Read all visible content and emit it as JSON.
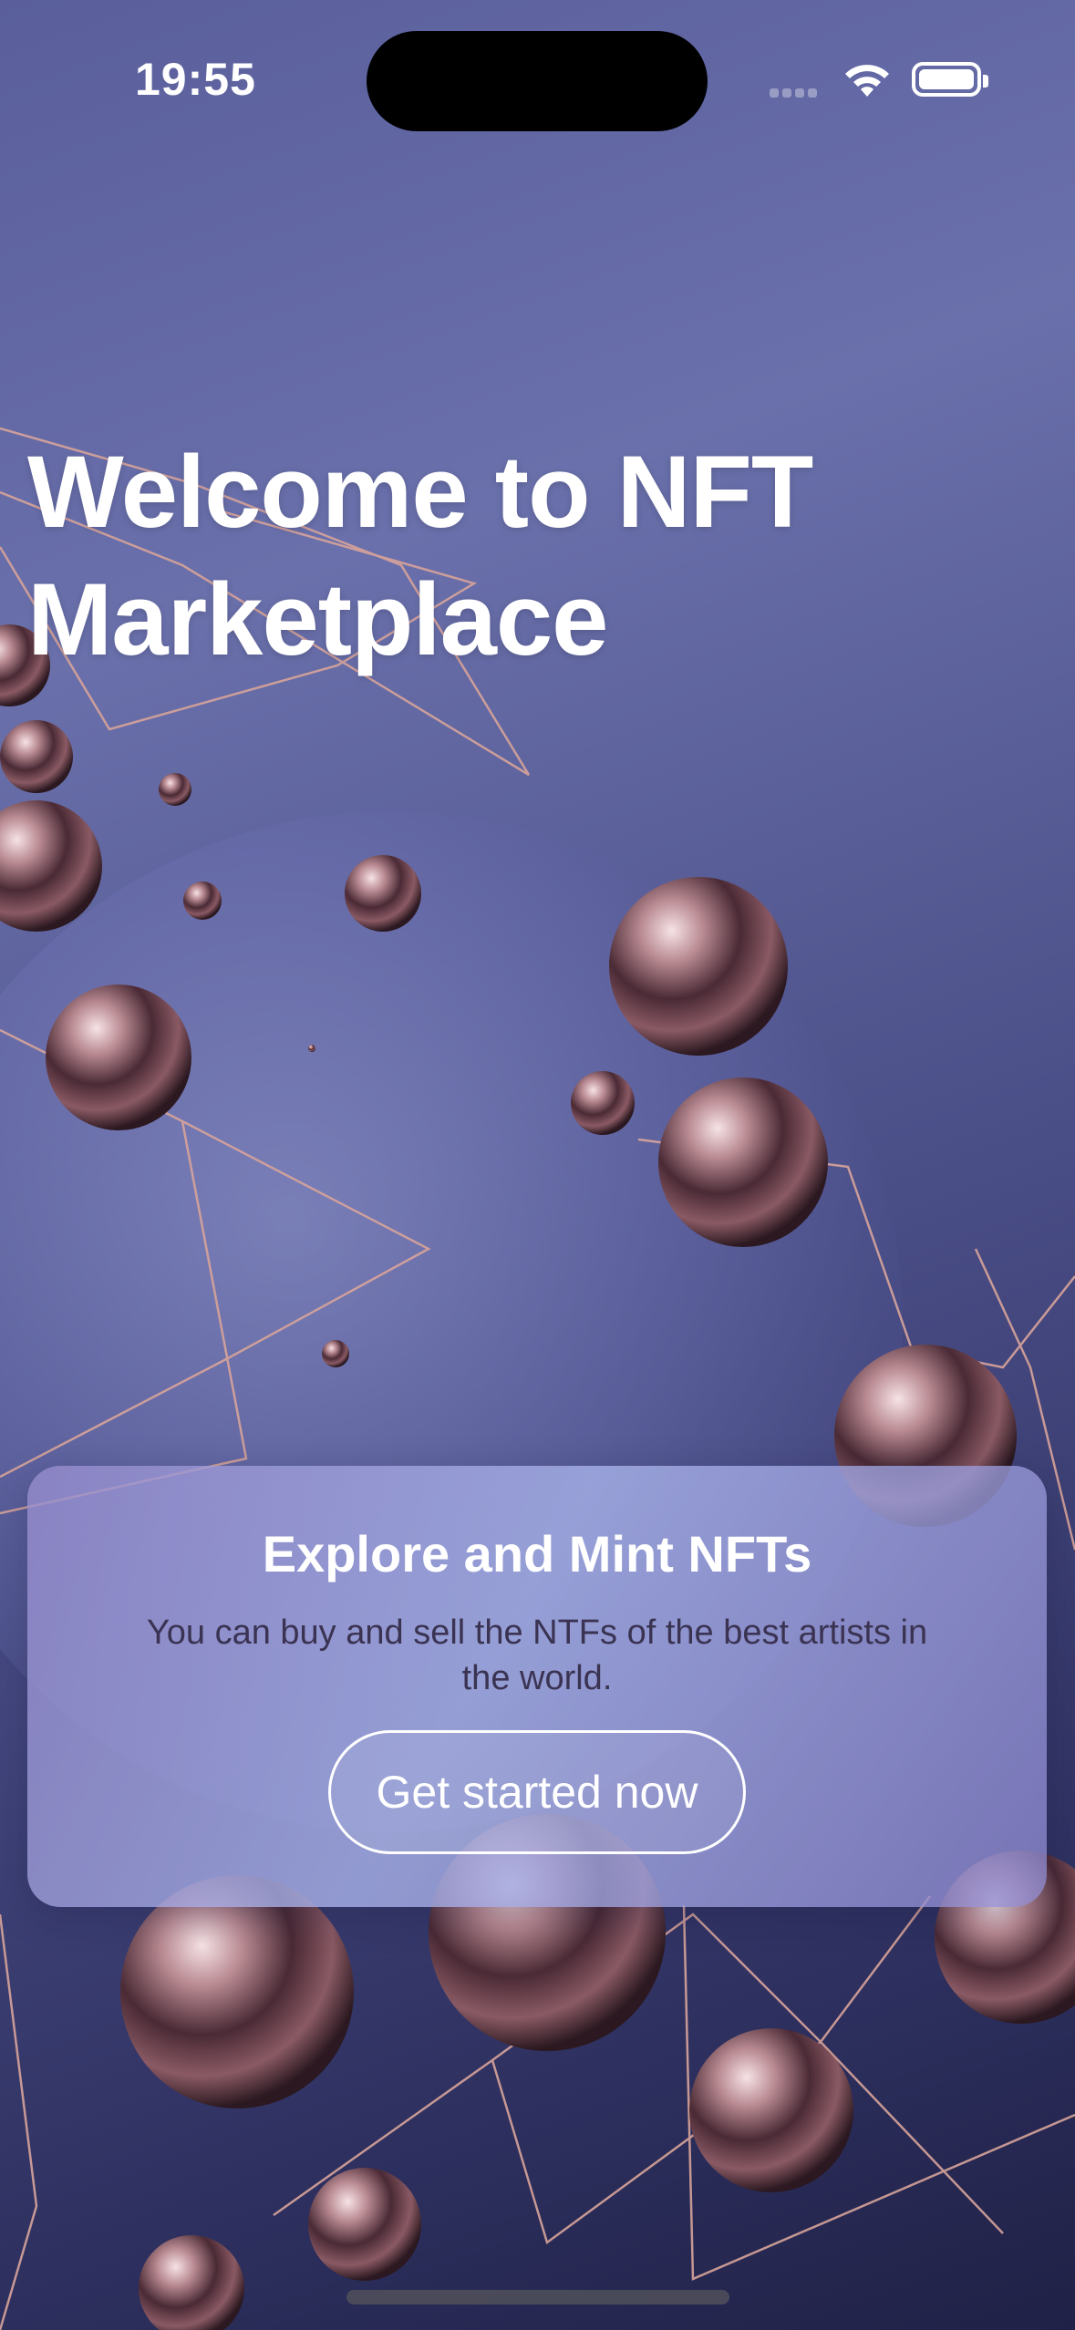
{
  "status_bar": {
    "time": "19:55",
    "icons": [
      "signal-icon",
      "wifi-icon",
      "battery-icon"
    ]
  },
  "hero": {
    "title": "Welcome to NFT Marketplace"
  },
  "card": {
    "title": "Explore and Mint NFTs",
    "description": "You can buy and sell the NTFs of the best artists in the world.",
    "button_label": "Get started now"
  },
  "colors": {
    "background": "#5a5f9c",
    "card": "#a6a8e0",
    "text_primary": "#ffffff",
    "text_secondary": "#3a3352"
  }
}
